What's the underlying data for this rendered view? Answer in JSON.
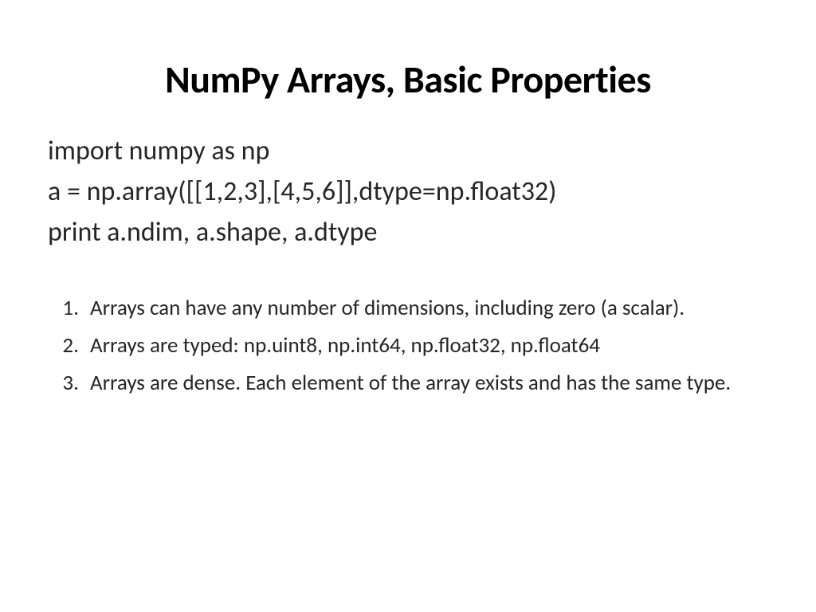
{
  "title": "NumPy Arrays, Basic Properties",
  "code": {
    "line1": "import numpy as np",
    "line2": "a = np.array([[1,2,3],[4,5,6]],dtype=np.float32)",
    "line3": "print a.ndim, a.shape, a.dtype"
  },
  "list": {
    "item1": "Arrays can have any number of dimensions, including zero (a scalar).",
    "item2": "Arrays are typed: np.uint8, np.int64, np.float32, np.float64",
    "item3": "Arrays are dense. Each element of the array exists and has the same type."
  }
}
